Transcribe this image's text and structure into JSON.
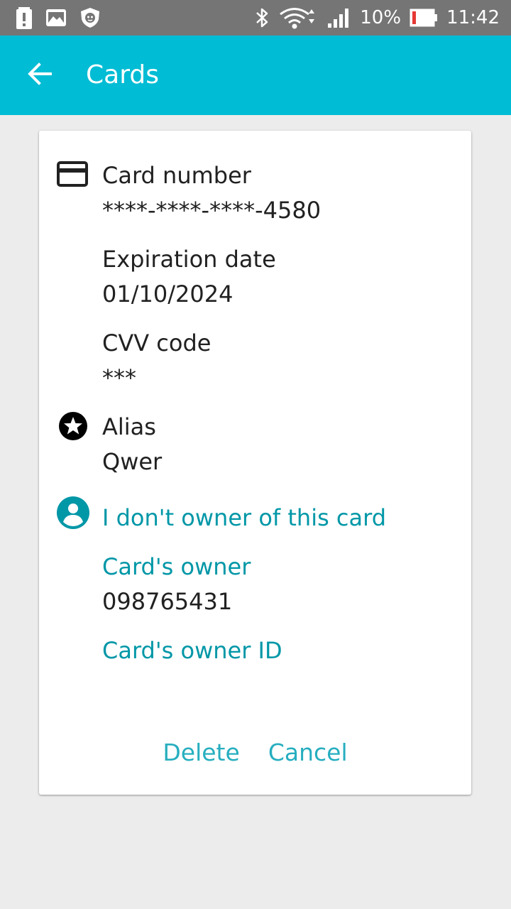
{
  "status_bar": {
    "icons_left": [
      "battery-alert-icon",
      "image-icon",
      "shield-lion-icon"
    ],
    "icons_right": [
      "bluetooth-icon",
      "wifi-icon",
      "cell-signal-icon",
      "battery-icon"
    ],
    "battery_percent": "10%",
    "time": "11:42"
  },
  "app_bar": {
    "title": "Cards",
    "back_icon": "arrow-back-icon"
  },
  "card": {
    "card_number_label": "Card number",
    "card_number_value": "****-****-****-4580",
    "expiration_label": "Expiration date",
    "expiration_value": "01/10/2024",
    "cvv_label": "CVV code",
    "cvv_value": "***",
    "alias_label": "Alias",
    "alias_value": "Qwer",
    "not_owner_link": "I don't owner of this card",
    "owner_label": "Card's owner",
    "owner_value": "098765431",
    "owner_id_label": "Card's owner ID"
  },
  "actions": {
    "delete_label": "Delete",
    "cancel_label": "Cancel"
  },
  "colors": {
    "app_bar": "#00bcd4",
    "status_bar": "#757575",
    "link": "#0097a7",
    "action": "#26aebf",
    "battery_low": "#e53935"
  }
}
